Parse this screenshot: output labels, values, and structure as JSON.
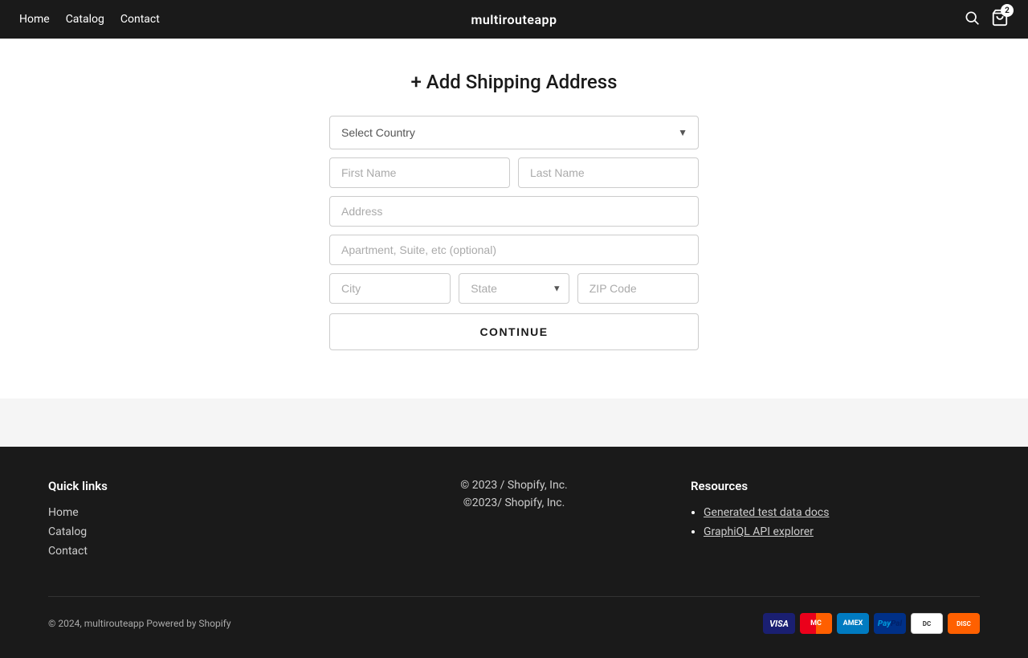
{
  "nav": {
    "links": [
      "Home",
      "Catalog",
      "Contact"
    ],
    "brand": "multirouteapp",
    "cart_count": "2"
  },
  "page": {
    "title": "+ Add Shipping Address"
  },
  "form": {
    "country_placeholder": "Select Country",
    "first_name_placeholder": "First Name",
    "last_name_placeholder": "Last Name",
    "address_placeholder": "Address",
    "apartment_placeholder": "Apartment, Suite, etc (optional)",
    "city_placeholder": "City",
    "state_placeholder": "State",
    "zip_placeholder": "ZIP Code",
    "continue_label": "CONTINUE"
  },
  "footer": {
    "quick_links_title": "Quick links",
    "quick_links": [
      "Home",
      "Catalog",
      "Contact"
    ],
    "copyright": "© 2023 / Shopify, Inc.",
    "copyright2": "©2023/ Shopify, Inc.",
    "resources_title": "Resources",
    "resources_links": [
      {
        "label": "Generated test data docs",
        "href": "#"
      },
      {
        "label": "GraphiQL API explorer",
        "href": "#"
      }
    ],
    "bottom_copyright": "© 2024, multirouteapp Powered by Shopify",
    "payment_methods": [
      "Visa",
      "Mastercard",
      "Amex",
      "PayPal",
      "Diners",
      "Discover"
    ]
  }
}
